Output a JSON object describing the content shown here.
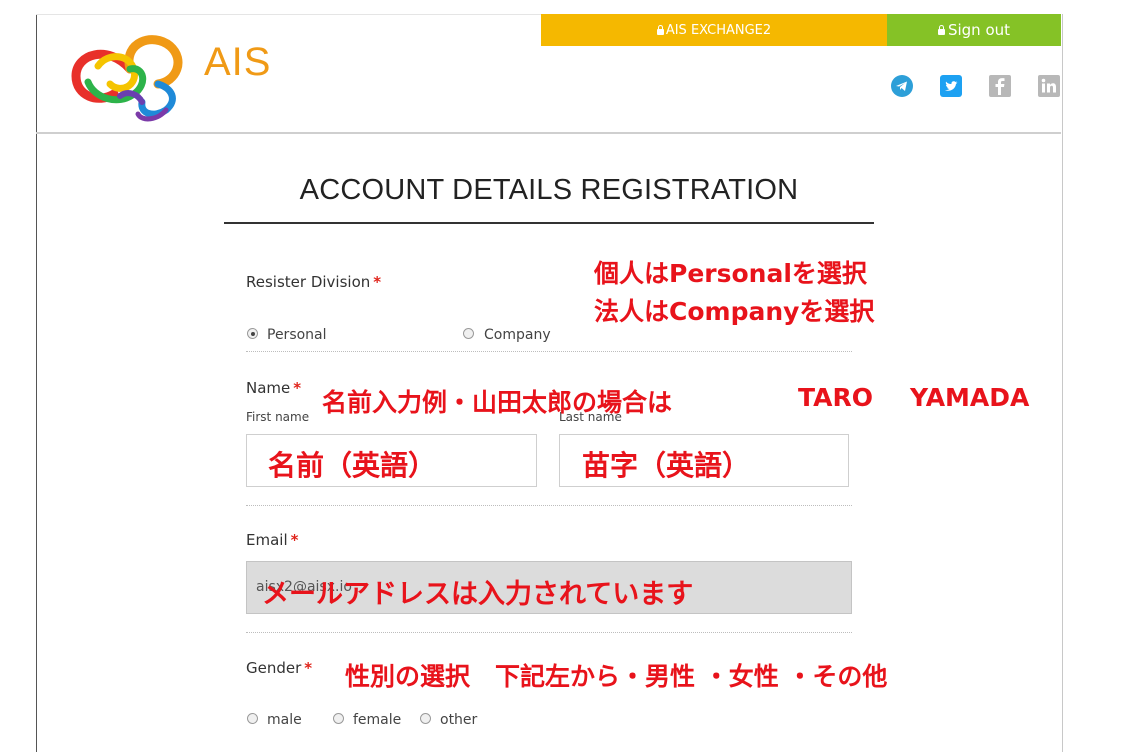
{
  "brand": {
    "name": "AIS"
  },
  "header": {
    "exchange_label": "AIS EXCHANGE2",
    "signout_label": "Sign out",
    "social_icons": [
      "telegram-icon",
      "twitter-icon",
      "facebook-icon",
      "linkedin-icon"
    ],
    "colors": {
      "exchange_bg": "#f5b800",
      "signout_bg": "#85c226",
      "telegram": "#2d9fd8",
      "twitter": "#1da1f2",
      "muted": "#b8b8b8"
    }
  },
  "page": {
    "title": "ACCOUNT DETAILS REGISTRATION"
  },
  "form": {
    "division": {
      "label": "Resister Division",
      "required_mark": "*",
      "options": [
        "Personal",
        "Company"
      ],
      "selected": "Personal"
    },
    "name": {
      "label": "Name",
      "required_mark": "*",
      "first_label": "First name",
      "last_label": "Last name"
    },
    "email": {
      "label": "Email",
      "required_mark": "*",
      "value": "aisx2@aisx.io"
    },
    "gender": {
      "label": "Gender",
      "required_mark": "*",
      "options": [
        "male",
        "female",
        "other"
      ]
    }
  },
  "annotations": {
    "division_line1": "個人はPersonalを選択",
    "division_line2": "法人はCompanyを選択",
    "name_example": "名前入力例・山田太郎の場合は",
    "name_first_example": "TARO",
    "name_last_example": "YAMADA",
    "first_name_hint": "名前（英語）",
    "last_name_hint": "苗字（英語）",
    "email_note": "メールアドレスは入力されています",
    "gender_note": "性別の選択　下記左から・男性 ・女性 ・その他",
    "color": "#e8131b"
  }
}
